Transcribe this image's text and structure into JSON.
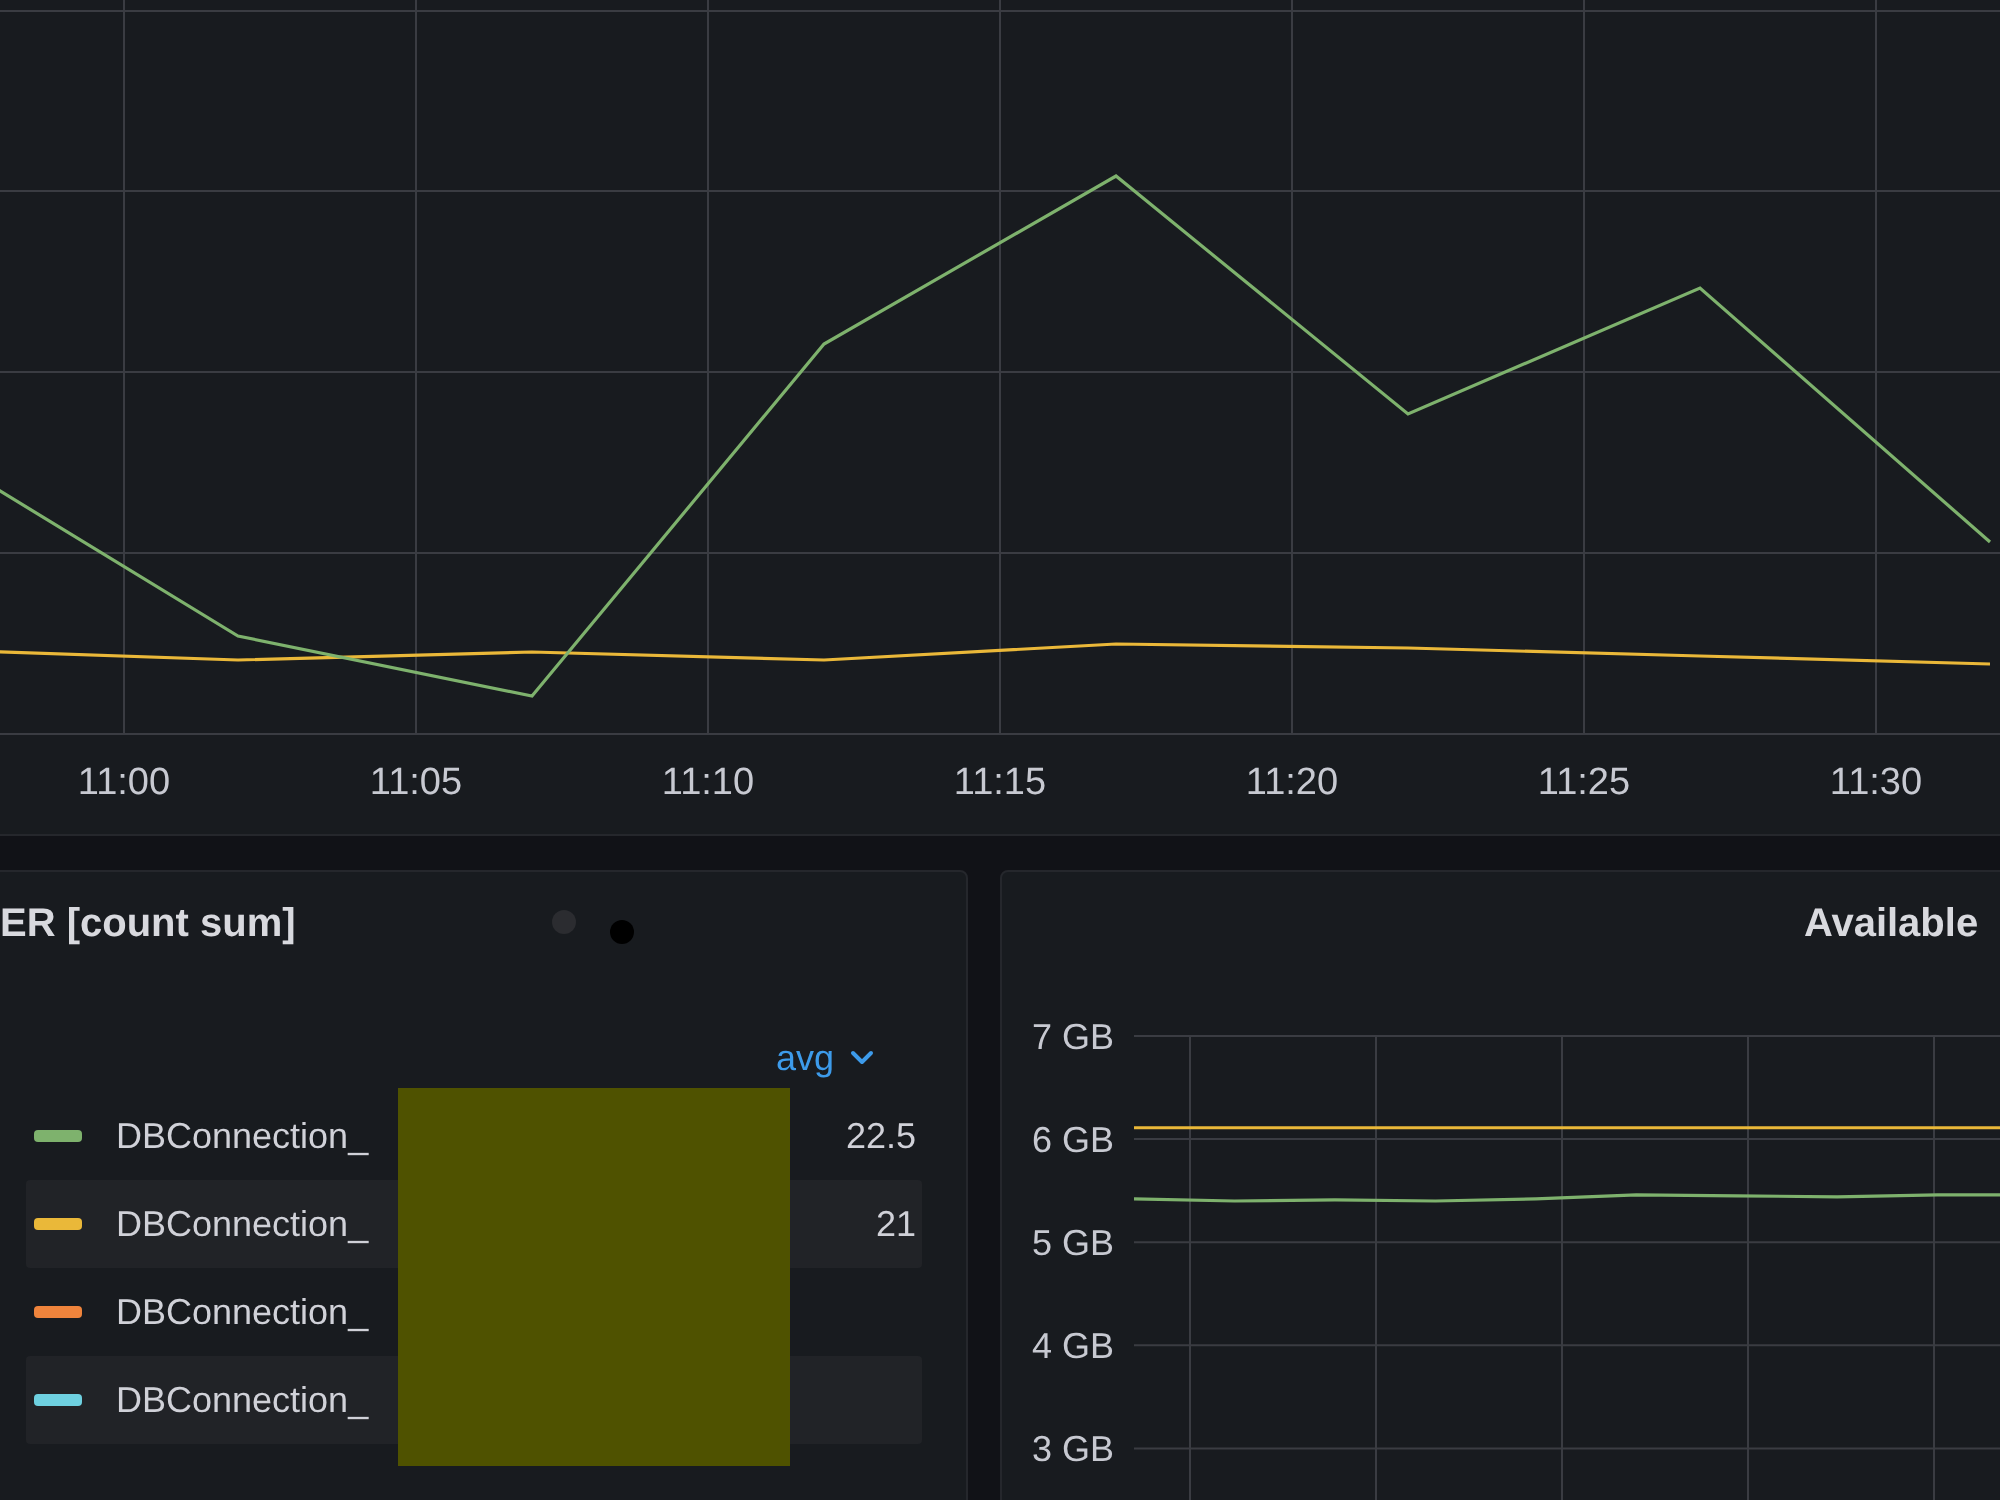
{
  "top_panel": {
    "x_axis_labels": [
      "11:00",
      "11:05",
      "11:10",
      "11:15",
      "11:20",
      "11:25",
      "11:30"
    ]
  },
  "count_panel": {
    "title": "ER [count sum]",
    "legend": {
      "column": {
        "label": "avg",
        "sorted": true
      },
      "rows": [
        {
          "color": "#7eb26d",
          "name": "DBConnection_",
          "value": "22.5"
        },
        {
          "color": "#eab839",
          "name": "DBConnection_",
          "value": "21"
        },
        {
          "color": "#ef843c",
          "name": "DBConnection_"
        },
        {
          "color": "#6ed0e0",
          "name": "DBConnection_"
        }
      ]
    }
  },
  "available_panel": {
    "title": "Available",
    "chart_data": {
      "type": "line",
      "ylim": [
        2.5,
        7
      ],
      "yticks": [
        {
          "value": 7,
          "label": "7 GB"
        },
        {
          "value": 6,
          "label": "6 GB"
        },
        {
          "value": 5,
          "label": "5 GB"
        },
        {
          "value": 4,
          "label": "4 GB"
        },
        {
          "value": 3,
          "label": "3 GB"
        }
      ],
      "grid": true,
      "series": [
        {
          "color": "#eab839",
          "values": [
            6.11,
            6.11,
            6.11,
            6.11,
            6.11,
            6.11,
            6.11,
            6.11,
            6.11,
            6.11
          ]
        },
        {
          "color": "#7eb26d",
          "values": [
            5.42,
            5.4,
            5.41,
            5.4,
            5.42,
            5.46,
            5.45,
            5.44,
            5.46,
            5.46
          ]
        }
      ]
    }
  }
}
